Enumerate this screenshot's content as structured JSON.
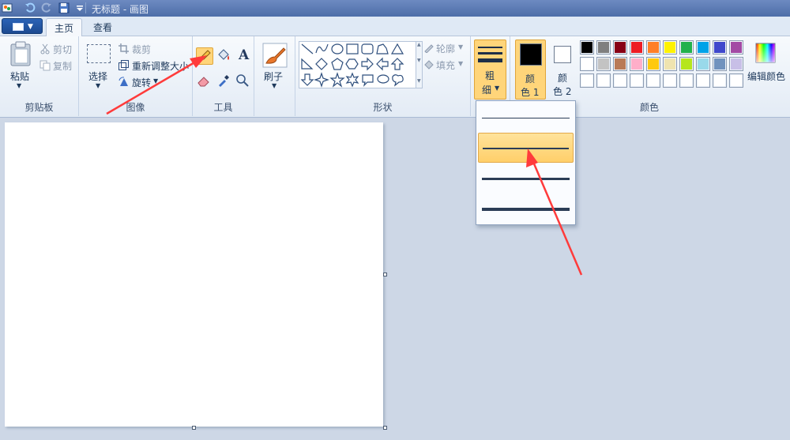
{
  "window": {
    "title": "无标题 - 画图"
  },
  "tabs": [
    {
      "label": "主页"
    },
    {
      "label": "查看"
    }
  ],
  "clipboard": {
    "paste": "粘贴",
    "cut": "剪切",
    "copy": "复制",
    "group": "剪贴板"
  },
  "image": {
    "select": "选择",
    "crop": "裁剪",
    "resize": "重新调整大小",
    "rotate": "旋转",
    "group": "图像"
  },
  "tools": {
    "group": "工具",
    "text_glyph": "A"
  },
  "brush": {
    "label": "刷子"
  },
  "shapes": {
    "outline": "轮廓",
    "fill": "填充",
    "group": "形状"
  },
  "size": {
    "label_line1": "粗",
    "label_line2": "细"
  },
  "color1": {
    "line1": "颜",
    "line2": "色 1",
    "value": "#000000"
  },
  "color2": {
    "line1": "颜",
    "line2": "色 2",
    "value": "#ffffff"
  },
  "colors": {
    "group": "颜色",
    "edit": "编辑颜色",
    "row1": [
      "#000000",
      "#7f7f7f",
      "#880015",
      "#ed1c24",
      "#ff7f27",
      "#fff200",
      "#22b14c",
      "#00a2e8",
      "#3f48cc",
      "#a349a4"
    ],
    "row2": [
      "#ffffff",
      "#c3c3c3",
      "#b97a57",
      "#ffaec9",
      "#ffc90e",
      "#efe4b0",
      "#b5e61d",
      "#99d9ea",
      "#7092be",
      "#c8bfe7"
    ],
    "row3": [
      "#ffffff",
      "#ffffff",
      "#ffffff",
      "#ffffff",
      "#ffffff",
      "#ffffff",
      "#ffffff",
      "#ffffff",
      "#ffffff",
      "#ffffff"
    ]
  },
  "size_options": {
    "selected_index": 1
  },
  "accent": {
    "selection": "#ffcf6a",
    "annotation_arrow": "#ff3b3b"
  }
}
